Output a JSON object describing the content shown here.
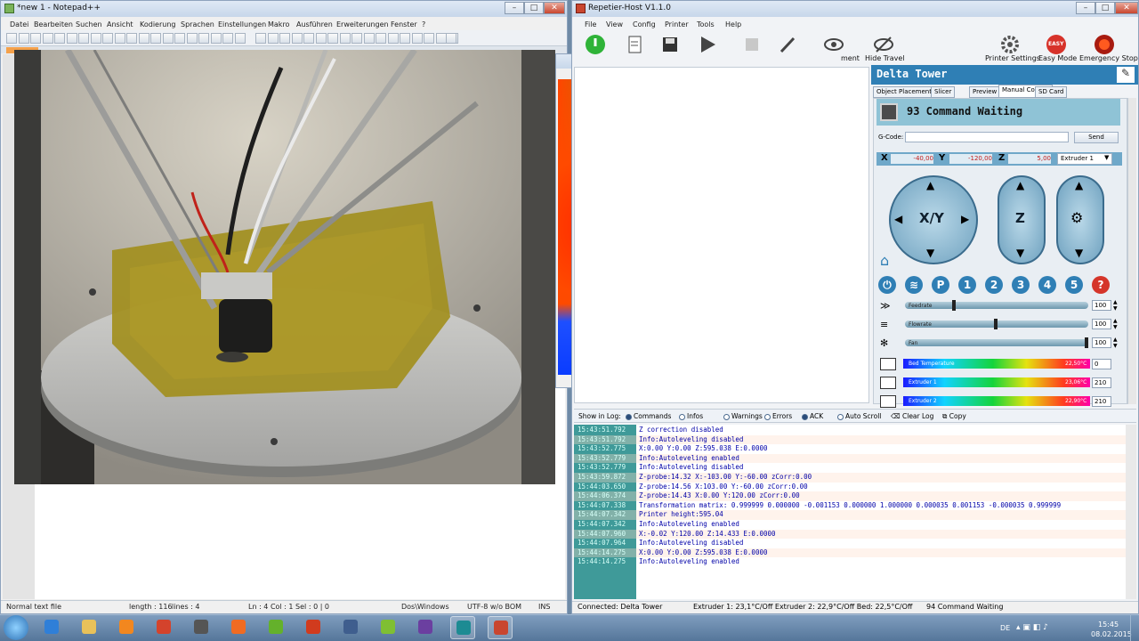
{
  "notepad": {
    "title": "*new  1 - Notepad++",
    "menu": [
      "Datei",
      "Bearbeiten",
      "Suchen",
      "Ansicht",
      "Kodierung",
      "Sprachen",
      "Einstellungen",
      "Makro",
      "Ausführen",
      "Erweiterungen",
      "Fenster",
      "?"
    ],
    "status": {
      "filetype": "Normal text file",
      "length": "length : 116",
      "lines": "lines : 4",
      "position": "Ln : 4    Col : 1    Sel : 0 | 0",
      "eol": "Dos\\Windows",
      "encoding": "UTF-8 w/o BOM",
      "mode": "INS"
    }
  },
  "repetier": {
    "title": "Repetier-Host V1.1.0",
    "menu": [
      "File",
      "View",
      "Config",
      "Printer",
      "Tools",
      "Help"
    ],
    "toolbar_right": [
      "Printer Settings",
      "Easy Mode",
      "Emergency Stop"
    ],
    "toolbar_partial": [
      "ment",
      "Hide Travel"
    ],
    "easy_badge": "EASY",
    "printer_name": "Delta Tower",
    "tabs": [
      "Object Placement",
      "Slicer",
      "Preview",
      "Manual Control",
      "SD Card"
    ],
    "active_tab": "Manual Control",
    "status_banner": "93 Command Waiting",
    "gcode_label": "G-Code:",
    "send_label": "Send",
    "coords": {
      "x_label": "X",
      "x": "-40,00",
      "y_label": "Y",
      "y": "-120,00",
      "z_label": "Z",
      "z": "5,00"
    },
    "extruder_select": "Extruder 1",
    "jog": {
      "xy": "X/Y",
      "z": "Z"
    },
    "num_buttons": [
      "P",
      "1",
      "2",
      "3",
      "4",
      "5",
      "?"
    ],
    "sliders": [
      {
        "label": "Feedrate",
        "value": "100",
        "level": 0.27
      },
      {
        "label": "Flowrate",
        "value": "100",
        "level": 0.5
      },
      {
        "label": "Fan",
        "value": "100",
        "level": 1.0
      }
    ],
    "temps": [
      {
        "label": "Bed Temperature",
        "reading": "22,50°C",
        "value": "0"
      },
      {
        "label": "Extruder 1",
        "reading": "23,06°C",
        "value": "210"
      },
      {
        "label": "Extruder 2",
        "reading": "22,90°C",
        "value": "210"
      }
    ],
    "log_toolbar": {
      "show_label": "Show in Log:",
      "items": [
        "Commands",
        "Infos",
        "Warnings",
        "Errors",
        "ACK",
        "Auto Scroll"
      ],
      "clear": "Clear Log",
      "copy": "Copy"
    },
    "log": [
      {
        "time": "15:43:51.792",
        "text": "Z correction disabled"
      },
      {
        "time": "15:43:51.792",
        "text": "Info:Autoleveling disabled"
      },
      {
        "time": "15:43:52.775",
        "text": "X:0.00 Y:0.00 Z:595.038 E:0.0000"
      },
      {
        "time": "15:43:52.779",
        "text": "Info:Autoleveling enabled"
      },
      {
        "time": "15:43:52.779",
        "text": "Info:Autoleveling disabled"
      },
      {
        "time": "15:43:59.872",
        "text": "Z-probe:14.32 X:-103.00 Y:-60.00 zCorr:0.00"
      },
      {
        "time": "15:44:03.650",
        "text": "Z-probe:14.56 X:103.00 Y:-60.00 zCorr:0.00"
      },
      {
        "time": "15:44:06.374",
        "text": "Z-probe:14.43 X:0.00 Y:120.00 zCorr:0.00"
      },
      {
        "time": "15:44:07.338",
        "text": "Transformation matrix: 0.999999 0.000000 -0.001153 0.000000 1.000000 0.000035 0.001153 -0.000035 0.999999"
      },
      {
        "time": "15:44:07.342",
        "text": "Printer height:595.04"
      },
      {
        "time": "15:44:07.342",
        "text": "Info:Autoleveling enabled"
      },
      {
        "time": "15:44:07.960",
        "text": "X:-0.02 Y:120.00 Z:14.433 E:0.0000"
      },
      {
        "time": "15:44:07.964",
        "text": "Info:Autoleveling disabled"
      },
      {
        "time": "15:44:14.275",
        "text": "X:0.00 Y:0.00 Z:595.038 E:0.0000"
      },
      {
        "time": "15:44:14.275",
        "text": "Info:Autoleveling enabled"
      }
    ],
    "status": {
      "connection": "Connected: Delta Tower",
      "temps": "Extruder 1: 23,1°C/Off Extruder 2: 22,9°C/Off Bed: 22,5°C/Off",
      "queue": "94 Command Waiting"
    }
  },
  "taskbar": {
    "lang": "DE",
    "time": "15:45",
    "date": "08.02.2015"
  },
  "colors": {
    "accent": "#2f7fb5",
    "banner": "#8fc3d6",
    "log_bg": "#3f9a99"
  }
}
